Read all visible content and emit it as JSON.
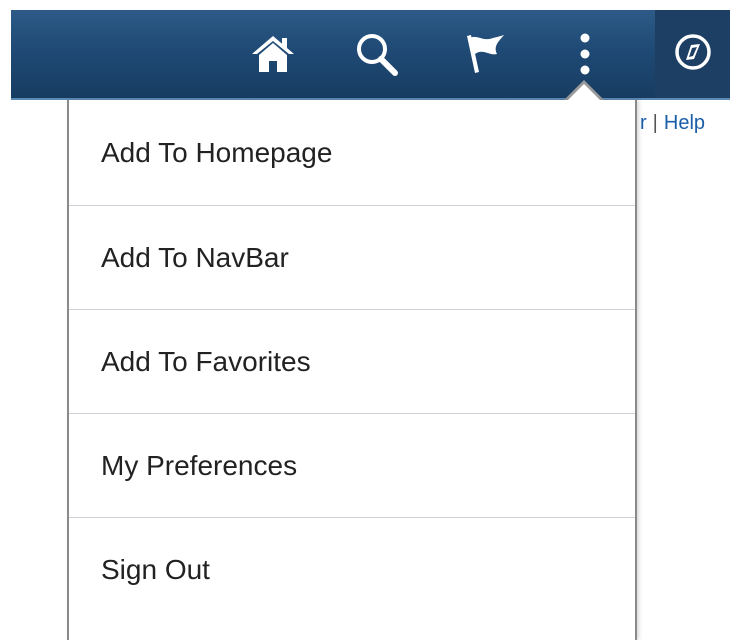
{
  "header": {
    "icons": {
      "home": "home-icon",
      "search": "search-icon",
      "flag": "flag-icon",
      "actions": "more-vertical-icon",
      "navbar": "compass-icon"
    },
    "colors": {
      "bar": "#1f4a75",
      "icon": "#ffffff"
    }
  },
  "background_links": {
    "partial": "r",
    "separator": "|",
    "help": "Help"
  },
  "menu": {
    "items": [
      {
        "label": "Add To Homepage"
      },
      {
        "label": "Add To NavBar"
      },
      {
        "label": "Add To Favorites"
      },
      {
        "label": "My Preferences"
      },
      {
        "label": "Sign Out"
      }
    ]
  }
}
